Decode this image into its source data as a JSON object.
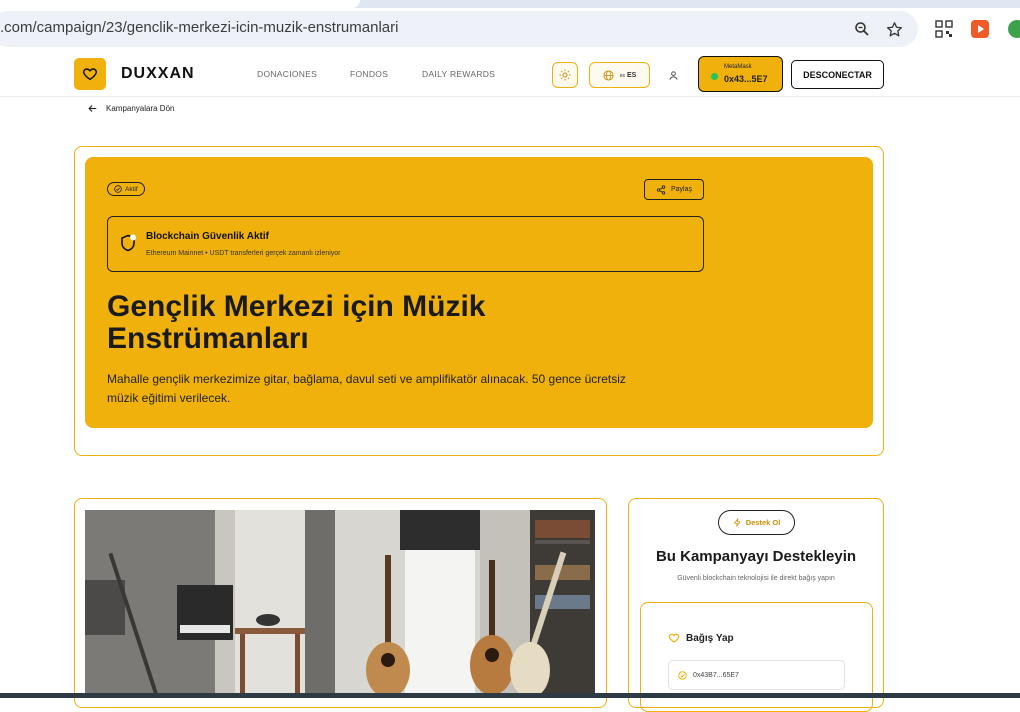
{
  "browser": {
    "url": ".com/campaign/23/genclik-merkezi-icin-muzik-enstrumanlari"
  },
  "header": {
    "brand": "DUXXAN",
    "nav": [
      "DONACIONES",
      "FONDOS",
      "DAILY REWARDS"
    ],
    "lang_code": "ES",
    "lang_prefix": "es",
    "wallet_label": "MetaMask",
    "wallet_address": "0x43...5E7",
    "disconnect_label": "DESCONECTAR"
  },
  "back_link": "Kampanyalara Dön",
  "hero": {
    "status": "Aktif",
    "share_label": "Paylaş",
    "security_title": "Blockchain Güvenlik Aktif",
    "security_subtitle": "Ethereum Mainnet • USDT transferleri gerçek zamanlı izleniyor",
    "title": "Gençlik Merkezi için Müzik Enstrümanları",
    "description": "Mahalle gençlik merkezimize gitar, bağlama, davul seti ve amplifikatör alınacak. 50 gence ücretsiz müzik eğitimi verilecek."
  },
  "donate": {
    "pill_label": "Destek Ol",
    "title": "Bu Kampanyayı Destekleyin",
    "subtitle": "Güvenli blockchain teknolojisi ile direkt bağış yapın",
    "section_label": "Bağış Yap",
    "address": "0x43B7...65E7"
  },
  "colors": {
    "accent": "#f0b10d",
    "wallet_dot": "#22c55e"
  }
}
